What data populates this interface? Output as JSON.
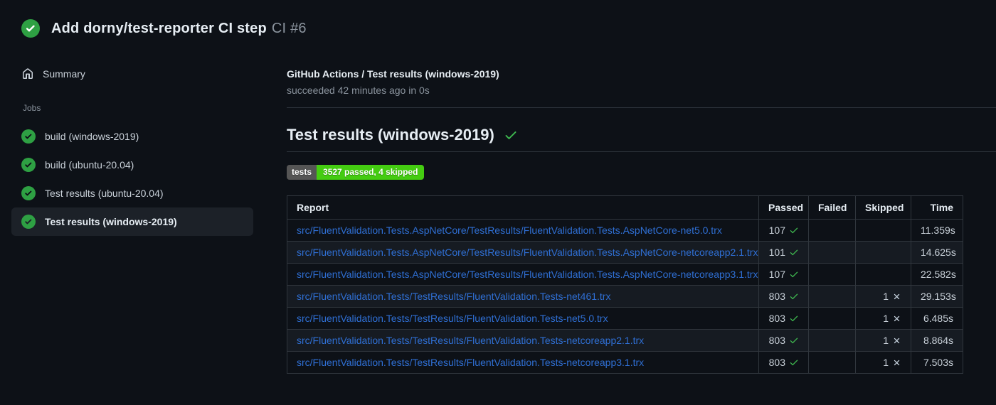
{
  "header": {
    "status": "success",
    "title": "Add dorny/test-reporter CI step",
    "run_number": "CI #6"
  },
  "sidebar": {
    "summary_label": "Summary",
    "jobs_section_label": "Jobs",
    "jobs": [
      {
        "label": "build (windows-2019)",
        "status": "success",
        "selected": false
      },
      {
        "label": "build (ubuntu-20.04)",
        "status": "success",
        "selected": false
      },
      {
        "label": "Test results (ubuntu-20.04)",
        "status": "success",
        "selected": false
      },
      {
        "label": "Test results (windows-2019)",
        "status": "success",
        "selected": true
      }
    ]
  },
  "check_run": {
    "title": "GitHub Actions / Test results (windows-2019)",
    "status_line": "succeeded 42 minutes ago in 0s",
    "heading": "Test results (windows-2019)",
    "heading_status": "success"
  },
  "badge": {
    "label": "tests",
    "value": "3527 passed, 4 skipped",
    "label_bg": "#555555",
    "value_bg": "#44cc11"
  },
  "results_table": {
    "headers": [
      "Report",
      "Passed",
      "Failed",
      "Skipped",
      "Time"
    ],
    "rows": [
      {
        "report": "src/FluentValidation.Tests.AspNetCore/TestResults/FluentValidation.Tests.AspNetCore-net5.0.trx",
        "passed": "107",
        "failed": "",
        "skipped": "",
        "time": "11.359s"
      },
      {
        "report": "src/FluentValidation.Tests.AspNetCore/TestResults/FluentValidation.Tests.AspNetCore-netcoreapp2.1.trx",
        "passed": "101",
        "failed": "",
        "skipped": "",
        "time": "14.625s"
      },
      {
        "report": "src/FluentValidation.Tests.AspNetCore/TestResults/FluentValidation.Tests.AspNetCore-netcoreapp3.1.trx",
        "passed": "107",
        "failed": "",
        "skipped": "",
        "time": "22.582s"
      },
      {
        "report": "src/FluentValidation.Tests/TestResults/FluentValidation.Tests-net461.trx",
        "passed": "803",
        "failed": "",
        "skipped": "1",
        "time": "29.153s"
      },
      {
        "report": "src/FluentValidation.Tests/TestResults/FluentValidation.Tests-net5.0.trx",
        "passed": "803",
        "failed": "",
        "skipped": "1",
        "time": "6.485s"
      },
      {
        "report": "src/FluentValidation.Tests/TestResults/FluentValidation.Tests-netcoreapp2.1.trx",
        "passed": "803",
        "failed": "",
        "skipped": "1",
        "time": "8.864s"
      },
      {
        "report": "src/FluentValidation.Tests/TestResults/FluentValidation.Tests-netcoreapp3.1.trx",
        "passed": "803",
        "failed": "",
        "skipped": "1",
        "time": "7.503s"
      }
    ]
  },
  "icons": {
    "run_status": "check-circle-icon",
    "summary": "home-icon",
    "job_status": "check-circle-icon",
    "heading_status": "check-icon",
    "passed": "check-icon",
    "skipped": "x-icon"
  },
  "colors": {
    "background": "#0d1117",
    "text": "#c9d1d9",
    "text_bright": "#e6edf3",
    "muted": "#8b949e",
    "table_border": "#30363d",
    "divider": "#2d333b",
    "link": "#2f6fd4",
    "success_circle": "#2ea043",
    "success_check": "#3fb950",
    "row_alt_bg": "#161b22",
    "selected_item_bg": "#1c2128"
  }
}
